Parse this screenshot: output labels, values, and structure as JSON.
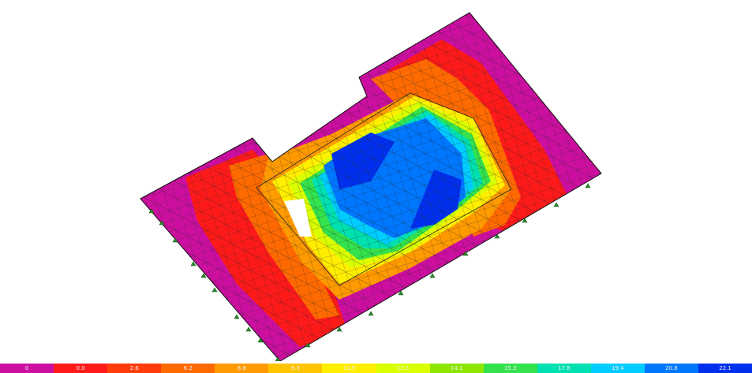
{
  "legend": {
    "colors": [
      "#cc0fa0",
      "#ff1a1a",
      "#ff3d0a",
      "#ff6a00",
      "#ff9a00",
      "#ffc400",
      "#ffee00",
      "#d9ff00",
      "#8ce600",
      "#33e24d",
      "#00e0b0",
      "#00ccff",
      "#0077ff",
      "#0030ee"
    ],
    "tick_labels": [
      "0",
      "0.0",
      "2.6",
      "6.2",
      "8.8",
      "9.3",
      "11.9",
      "12.5",
      "14.1",
      "15.3",
      "17.8",
      "19.4",
      "20.8",
      "22.1"
    ]
  },
  "support_icon": "support-marker-icon"
}
